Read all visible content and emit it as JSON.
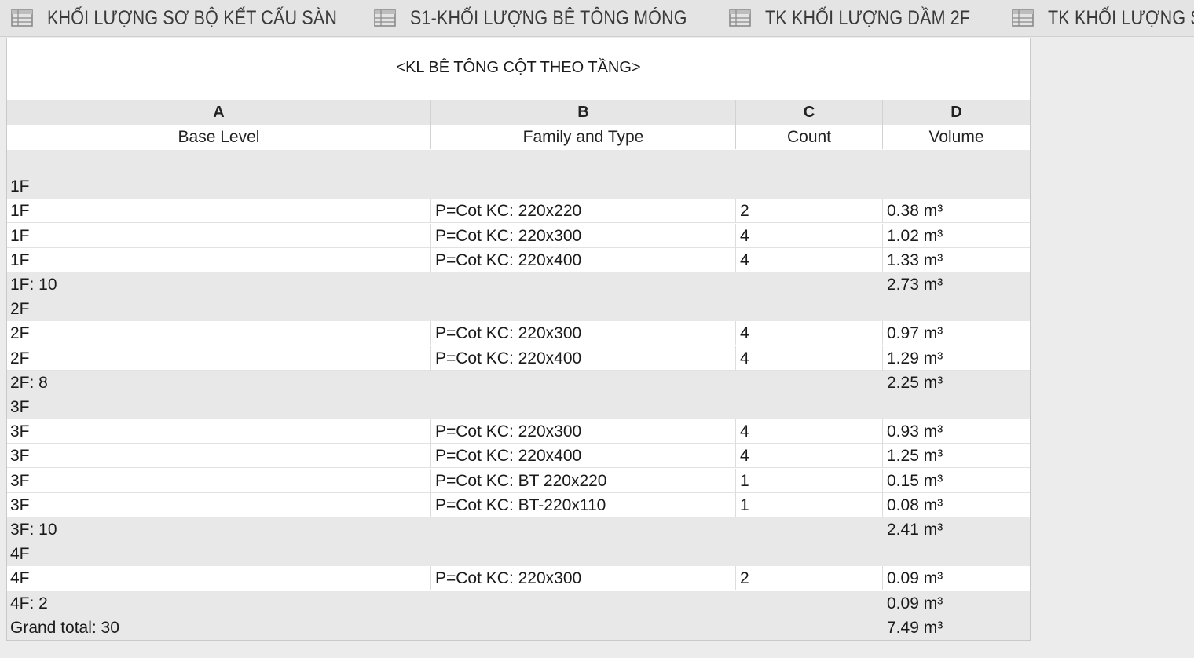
{
  "tabs": [
    {
      "label": "KHỐI LƯỢNG SƠ BỘ KẾT CẤU SÀN",
      "icon": "schedule-table-icon"
    },
    {
      "label": "S1-KHỐI LƯỢNG BÊ TÔNG MÓNG",
      "icon": "schedule-table-icon"
    },
    {
      "label": "TK KHỐI LƯỢNG DẦM 2F",
      "icon": "schedule-table-icon"
    },
    {
      "label": "TK KHỐI LƯỢNG S",
      "icon": "schedule-table-icon"
    }
  ],
  "schedule": {
    "title": "<KL BÊ TÔNG CỘT THEO TẦNG>",
    "columns": [
      {
        "letter": "A",
        "name": "Base Level"
      },
      {
        "letter": "B",
        "name": "Family and Type"
      },
      {
        "letter": "C",
        "name": "Count"
      },
      {
        "letter": "D",
        "name": "Volume"
      }
    ],
    "rows": [
      {
        "kind": "spacer",
        "a": "",
        "b": "",
        "c": "",
        "d": ""
      },
      {
        "kind": "group",
        "a": "1F",
        "b": "",
        "c": "",
        "d": ""
      },
      {
        "kind": "detail",
        "a": "1F",
        "b": "P=Cot KC: 220x220",
        "c": "2",
        "d": "0.38 m³"
      },
      {
        "kind": "detail",
        "a": "1F",
        "b": "P=Cot KC: 220x300",
        "c": "4",
        "d": "1.02 m³"
      },
      {
        "kind": "detail",
        "a": "1F",
        "b": "P=Cot KC: 220x400",
        "c": "4",
        "d": "1.33 m³"
      },
      {
        "kind": "subtotal",
        "a": "1F: 10",
        "b": "",
        "c": "",
        "d": "2.73 m³"
      },
      {
        "kind": "group",
        "a": "2F",
        "b": "",
        "c": "",
        "d": ""
      },
      {
        "kind": "detail",
        "a": "2F",
        "b": "P=Cot KC: 220x300",
        "c": "4",
        "d": "0.97 m³"
      },
      {
        "kind": "detail",
        "a": "2F",
        "b": "P=Cot KC: 220x400",
        "c": "4",
        "d": "1.29 m³"
      },
      {
        "kind": "subtotal",
        "a": "2F: 8",
        "b": "",
        "c": "",
        "d": "2.25 m³"
      },
      {
        "kind": "group",
        "a": "3F",
        "b": "",
        "c": "",
        "d": ""
      },
      {
        "kind": "detail",
        "a": "3F",
        "b": "P=Cot KC: 220x300",
        "c": "4",
        "d": "0.93 m³"
      },
      {
        "kind": "detail",
        "a": "3F",
        "b": "P=Cot KC: 220x400",
        "c": "4",
        "d": "1.25 m³"
      },
      {
        "kind": "detail",
        "a": "3F",
        "b": "P=Cot KC: BT 220x220",
        "c": "1",
        "d": "0.15 m³"
      },
      {
        "kind": "detail",
        "a": "3F",
        "b": "P=Cot KC: BT-220x110",
        "c": "1",
        "d": "0.08 m³"
      },
      {
        "kind": "subtotal",
        "a": "3F: 10",
        "b": "",
        "c": "",
        "d": "2.41 m³"
      },
      {
        "kind": "group",
        "a": "4F",
        "b": "",
        "c": "",
        "d": ""
      },
      {
        "kind": "detail",
        "a": "4F",
        "b": "P=Cot KC: 220x300",
        "c": "2",
        "d": "0.09 m³"
      },
      {
        "kind": "subtotal",
        "a": "4F: 2",
        "b": "",
        "c": "",
        "d": "0.09 m³"
      },
      {
        "kind": "total",
        "a": "Grand total: 30",
        "b": "",
        "c": "",
        "d": "7.49 m³"
      }
    ]
  }
}
